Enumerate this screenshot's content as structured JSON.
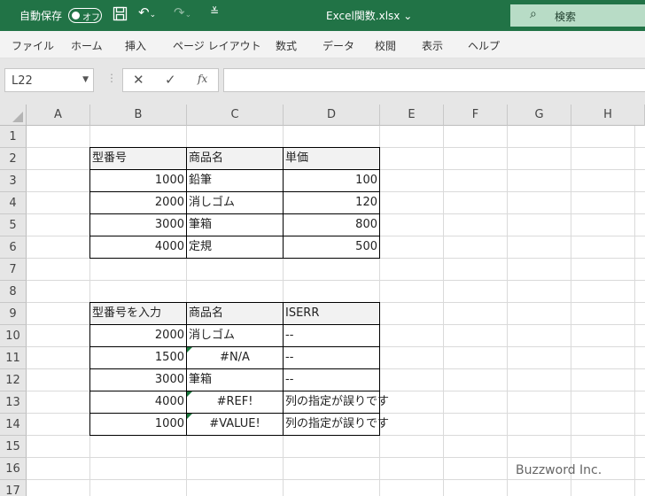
{
  "titlebar": {
    "autosave_label": "自動保存",
    "toggle_label": "オフ",
    "filename": "Excel関数.xlsx ⌄",
    "search_placeholder": "検索"
  },
  "ribbon": {
    "tabs": [
      "ファイル",
      "ホーム",
      "挿入",
      "ページ レイアウト",
      "数式",
      "データ",
      "校閲",
      "表示",
      "ヘルプ"
    ]
  },
  "formula_bar": {
    "name_box": "L22",
    "formula": ""
  },
  "sheet": {
    "columns": [
      "A",
      "B",
      "C",
      "D",
      "E",
      "F",
      "G",
      "H"
    ],
    "rows": [
      "1",
      "2",
      "3",
      "4",
      "5",
      "6",
      "7",
      "8",
      "9",
      "10",
      "11",
      "12",
      "13",
      "14",
      "15",
      "16",
      "17"
    ],
    "table1": {
      "headers": [
        "型番号",
        "商品名",
        "単価"
      ],
      "rows": [
        [
          "1000",
          "鉛筆",
          "100"
        ],
        [
          "2000",
          "消しゴム",
          "120"
        ],
        [
          "3000",
          "筆箱",
          "800"
        ],
        [
          "4000",
          "定規",
          "500"
        ]
      ]
    },
    "table2": {
      "headers": [
        "型番号を入力",
        "商品名",
        "ISERR"
      ],
      "rows": [
        [
          "2000",
          "消しゴム",
          "--"
        ],
        [
          "1500",
          "#N/A",
          "--"
        ],
        [
          "3000",
          "筆箱",
          "--"
        ],
        [
          "4000",
          "#REF!",
          "列の指定が誤りです"
        ],
        [
          "1000",
          "#VALUE!",
          "列の指定が誤りです"
        ]
      ]
    }
  },
  "watermark": "Buzzword Inc.",
  "colors": {
    "excel_green": "#217346",
    "error_indicator": "#1a7a3e"
  }
}
